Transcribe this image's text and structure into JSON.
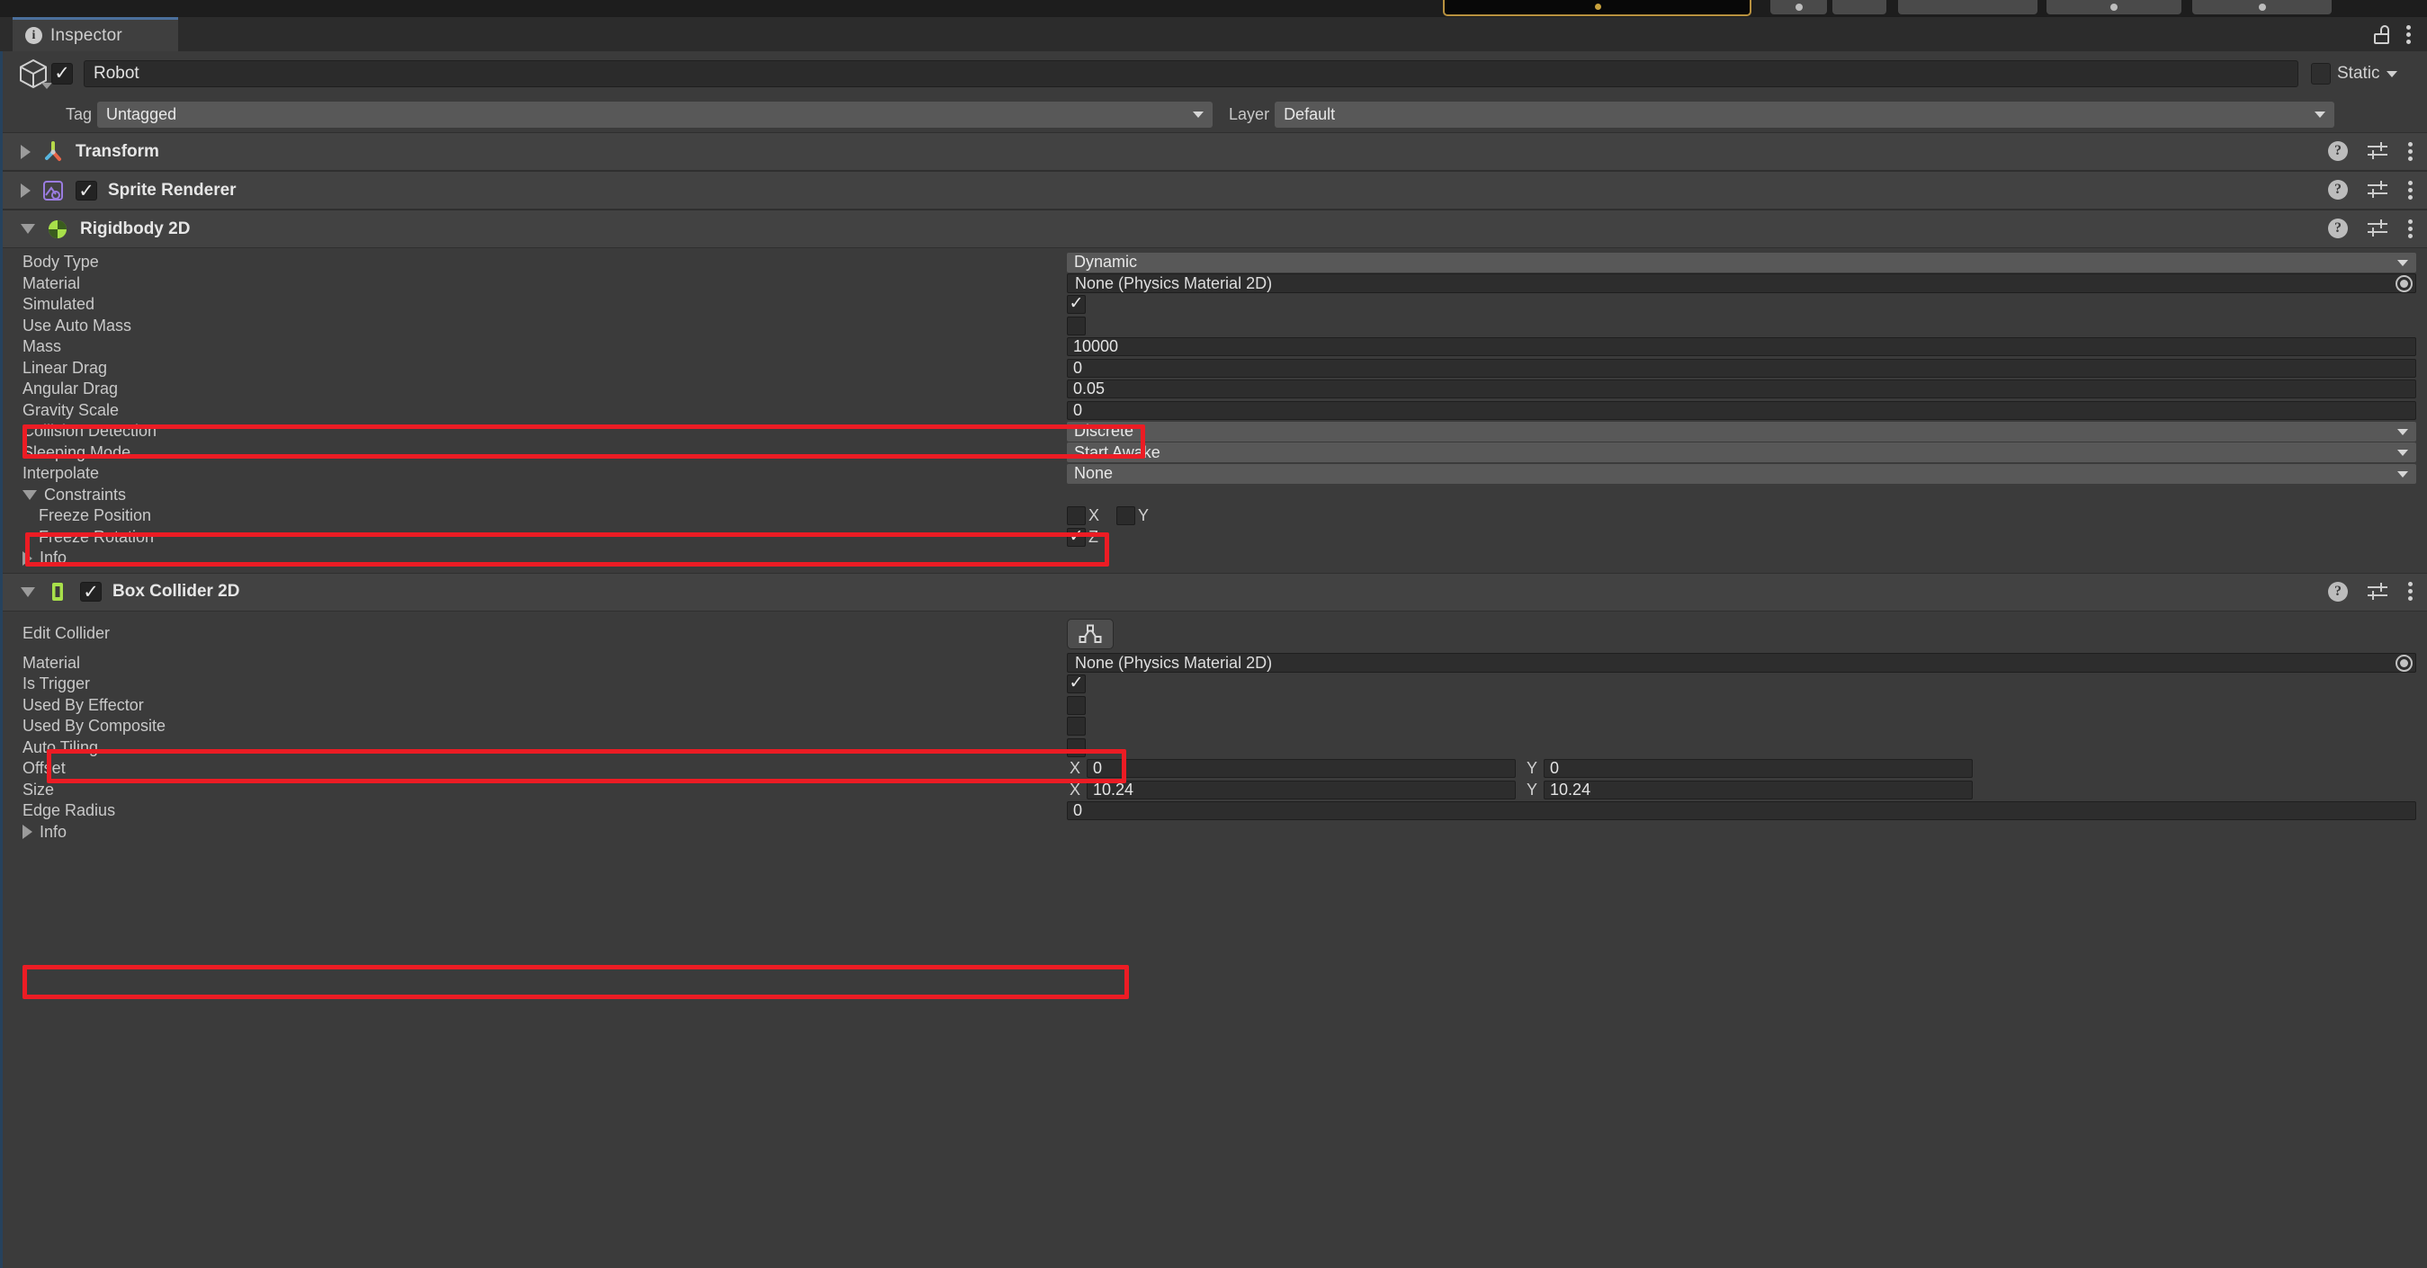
{
  "window": {
    "tab_label": "Inspector",
    "tab_icon": "info-icon",
    "lock_icon": "unlock-icon",
    "menu_icon": "kebab-menu-icon",
    "accent_tab": "#4b6f9c",
    "annotation_color": "#ec1c24"
  },
  "object": {
    "icon": "game-object-cube-icon",
    "enabled": true,
    "name": "Robot",
    "static_label": "Static",
    "tag_label": "Tag",
    "tag_value": "Untagged",
    "layer_label": "Layer",
    "layer_value": "Default"
  },
  "components": [
    {
      "name": "Transform",
      "icon": "transform-axis-icon",
      "expanded": false,
      "has_enable_checkbox": false
    },
    {
      "name": "Sprite Renderer",
      "icon": "sprite-renderer-icon",
      "expanded": false,
      "has_enable_checkbox": true,
      "enabled": true
    },
    {
      "name": "Rigidbody 2D",
      "icon": "rigidbody2d-icon",
      "expanded": true,
      "has_enable_checkbox": false,
      "properties": [
        {
          "label": "Body Type",
          "type": "dropdown",
          "value": "Dynamic"
        },
        {
          "label": "Material",
          "type": "object",
          "value": "None (Physics Material 2D)"
        },
        {
          "label": "Simulated",
          "type": "checkbox",
          "value": true
        },
        {
          "label": "Use Auto Mass",
          "type": "checkbox",
          "value": false
        },
        {
          "label": "Mass",
          "type": "number",
          "value": "10000",
          "highlight": true
        },
        {
          "label": "Linear Drag",
          "type": "number",
          "value": "0"
        },
        {
          "label": "Angular Drag",
          "type": "number",
          "value": "0.05"
        },
        {
          "label": "Gravity Scale",
          "type": "number",
          "value": "0",
          "highlight": true
        },
        {
          "label": "Collision Detection",
          "type": "dropdown",
          "value": "Discrete"
        },
        {
          "label": "Sleeping Mode",
          "type": "dropdown",
          "value": "Start Awake"
        },
        {
          "label": "Interpolate",
          "type": "dropdown",
          "value": "None"
        },
        {
          "label": "Constraints",
          "type": "foldout",
          "expanded": true
        },
        {
          "label": "Freeze Position",
          "type": "axes",
          "axes": [
            {
              "axis": "X",
              "value": false
            },
            {
              "axis": "Y",
              "value": false
            }
          ]
        },
        {
          "label": "Freeze Rotation",
          "type": "axes",
          "axes": [
            {
              "axis": "Z",
              "value": true
            }
          ],
          "highlight": true
        },
        {
          "label": "Info",
          "type": "foldout",
          "expanded": false
        }
      ]
    },
    {
      "name": "Box Collider 2D",
      "icon": "box-collider-2d-icon",
      "expanded": true,
      "has_enable_checkbox": true,
      "enabled": true,
      "properties": [
        {
          "label": "Edit Collider",
          "type": "button",
          "icon": "edit-collider-icon"
        },
        {
          "label": "Material",
          "type": "object",
          "value": "None (Physics Material 2D)"
        },
        {
          "label": "Is Trigger",
          "type": "checkbox",
          "value": true,
          "highlight": true
        },
        {
          "label": "Used By Effector",
          "type": "checkbox",
          "value": false
        },
        {
          "label": "Used By Composite",
          "type": "checkbox",
          "value": false
        },
        {
          "label": "Auto Tiling",
          "type": "checkbox",
          "value": false
        },
        {
          "label": "Offset",
          "type": "vector2",
          "x": "0",
          "y": "0"
        },
        {
          "label": "Size",
          "type": "vector2",
          "x": "10.24",
          "y": "10.24"
        },
        {
          "label": "Edge Radius",
          "type": "number",
          "value": "0",
          "wide": true
        },
        {
          "label": "Info",
          "type": "foldout",
          "expanded": false
        }
      ]
    }
  ]
}
